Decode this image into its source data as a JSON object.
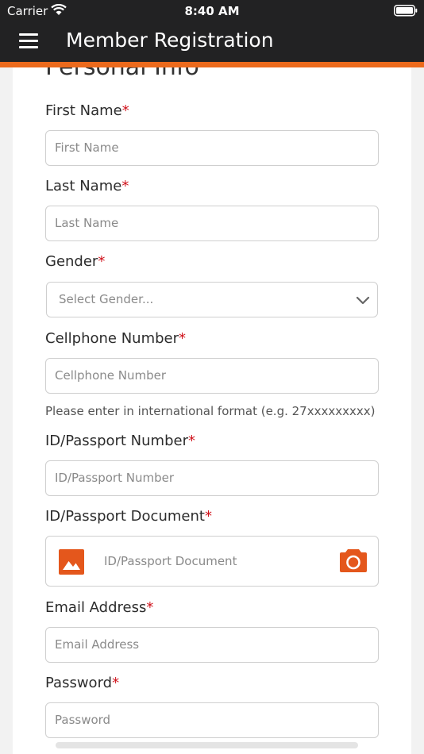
{
  "status_bar": {
    "carrier": "Carrier",
    "time": "8:40 AM"
  },
  "header": {
    "title": "Member Registration",
    "accent_color": "#ec6a1c",
    "background_color": "#222223"
  },
  "form": {
    "section_title": "Personal Info",
    "required_marker": "*",
    "fields": {
      "first_name": {
        "label": "First Name",
        "placeholder": "First Name",
        "value": ""
      },
      "last_name": {
        "label": "Last Name",
        "placeholder": "Last Name",
        "value": ""
      },
      "gender": {
        "label": "Gender",
        "selected": "Select Gender..."
      },
      "cellphone": {
        "label": "Cellphone Number",
        "placeholder": "Cellphone Number",
        "value": "",
        "help": "Please enter in international format (e.g. 27xxxxxxxxx)"
      },
      "id_number": {
        "label": "ID/Passport Number",
        "placeholder": "ID/Passport Number",
        "value": ""
      },
      "id_document": {
        "label": "ID/Passport Document",
        "placeholder": "ID/Passport Document",
        "icons": [
          "gallery-icon",
          "camera-icon"
        ]
      },
      "email": {
        "label": "Email Address",
        "placeholder": "Email Address",
        "value": ""
      },
      "password": {
        "label": "Password",
        "placeholder": "Password",
        "value": ""
      }
    }
  }
}
